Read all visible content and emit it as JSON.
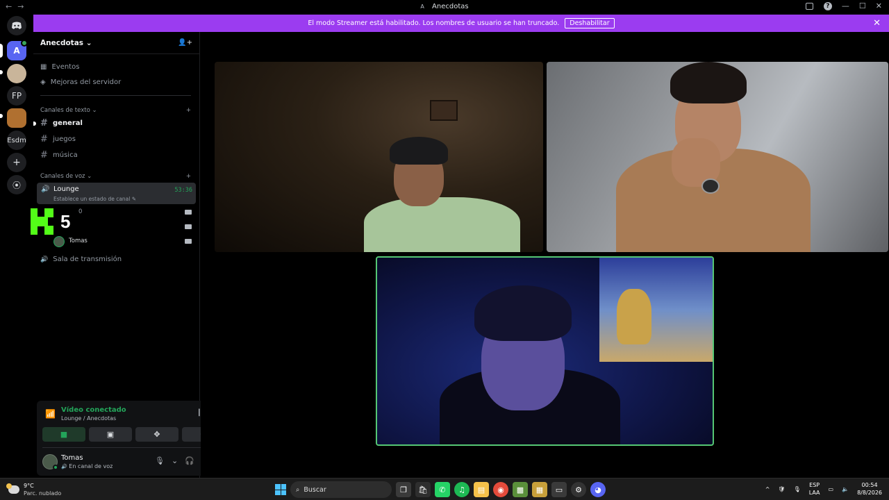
{
  "window": {
    "title": "Anecdotas",
    "app_letter": "A",
    "back_glyph": "←",
    "forward_glyph": "→",
    "help_glyph": "?",
    "minimize_glyph": "—",
    "maximize_glyph": "☐",
    "close_glyph": "✕"
  },
  "banner": {
    "text": "El modo Streamer está habilitado. Los nombres de usuario se han truncado.",
    "button_label": "Deshabilitar",
    "close_glyph": "✕",
    "color": "#9b3cf0"
  },
  "servers": [
    {
      "label": "A",
      "icon": "server-anecdotas"
    },
    {
      "label": "",
      "icon": "server-avatar-cartoon"
    },
    {
      "label": "FP",
      "icon": "server-fp"
    },
    {
      "label": "",
      "icon": "server-avatar-food"
    },
    {
      "label": "Esdm",
      "icon": "server-esdm"
    },
    {
      "label": "+",
      "icon": "add-server-icon"
    },
    {
      "label": "⦿",
      "icon": "explore-icon"
    }
  ],
  "sidebar": {
    "server_name": "Anecdotas",
    "server_chevron": "⌄",
    "invite_glyph": "👤+",
    "items": [
      {
        "label": "Eventos",
        "icon": "calendar-icon",
        "glyph": "▦"
      },
      {
        "label": "Mejoras del servidor",
        "icon": "boost-icon",
        "glyph": "◈"
      }
    ],
    "text_category": "Canales de texto ⌄",
    "voice_category": "Canales de voz ⌄",
    "add_glyph": "+",
    "hash_glyph": "#",
    "text_channels": [
      "general",
      "juegos",
      "música"
    ],
    "voice_channel": {
      "name": "Lounge",
      "status": "Establece un estado de canal",
      "status_edit_glyph": "✎",
      "time": "53:36",
      "speaker_glyph": "🔊"
    },
    "voice_members": [
      {
        "name": "0",
        "camera": true
      },
      {
        "name": "",
        "camera": true
      },
      {
        "name": "Tomas",
        "camera": true
      }
    ],
    "stage_channel": "Sala de transmisión",
    "stage_glyph": "🔊"
  },
  "overlay": {
    "number": "5",
    "logo_color": "#53fc18"
  },
  "voice_panel": {
    "status": "Vídeo conectado",
    "location": "Lounge / Anecdotas",
    "signal_glyph": "📶",
    "noise_glyph": "┃┃",
    "disconnect_glyph": "☎",
    "buttons": [
      {
        "name": "camera-button",
        "glyph": "■",
        "active": true
      },
      {
        "name": "screen-share-button",
        "glyph": "▣",
        "active": false
      },
      {
        "name": "activities-button",
        "glyph": "✥",
        "active": false
      },
      {
        "name": "soundboard-button",
        "glyph": "✺",
        "active": false
      }
    ],
    "accent_color": "#23a55a"
  },
  "user": {
    "name": "Tomas",
    "status": "En canal de voz",
    "status_glyph": "🔊",
    "mic_glyph": "🎙",
    "headphones_glyph": "🎧",
    "chevron_glyph": "⌄",
    "settings_glyph": "⚙"
  },
  "taskbar": {
    "weather_temp": "9°C",
    "weather_desc": "Parc. nublado",
    "search_placeholder": "Buscar",
    "search_glyph": "⌕",
    "apps": [
      {
        "name": "task-view",
        "glyph": "❐",
        "color": "#3a3a3a"
      },
      {
        "name": "store",
        "glyph": "🛍",
        "color": "#2e2e2e"
      },
      {
        "name": "whatsapp",
        "glyph": "✆",
        "color": "#25d366"
      },
      {
        "name": "spotify",
        "glyph": "♫",
        "color": "#1db954"
      },
      {
        "name": "file-explorer",
        "glyph": "▤",
        "color": "#f6c24a"
      },
      {
        "name": "chrome",
        "glyph": "◉",
        "color": "#e44b3b"
      },
      {
        "name": "minecraft",
        "glyph": "▩",
        "color": "#5a8f3a"
      },
      {
        "name": "game",
        "glyph": "▦",
        "color": "#c8a03a"
      },
      {
        "name": "app-window",
        "glyph": "▭",
        "color": "#3a3a3a"
      },
      {
        "name": "steam",
        "glyph": "⚙",
        "color": "#333"
      },
      {
        "name": "discord",
        "glyph": "◕",
        "color": "#5865f2"
      }
    ],
    "tray_chevron": "^",
    "tray_icons": [
      "🛡",
      "🎙"
    ],
    "lang_line1": "ESP",
    "lang_line2": "LAA",
    "network_glyph": "▭",
    "volume_glyph": "🔈",
    "time": "00:54",
    "date": "8/8/2026"
  }
}
